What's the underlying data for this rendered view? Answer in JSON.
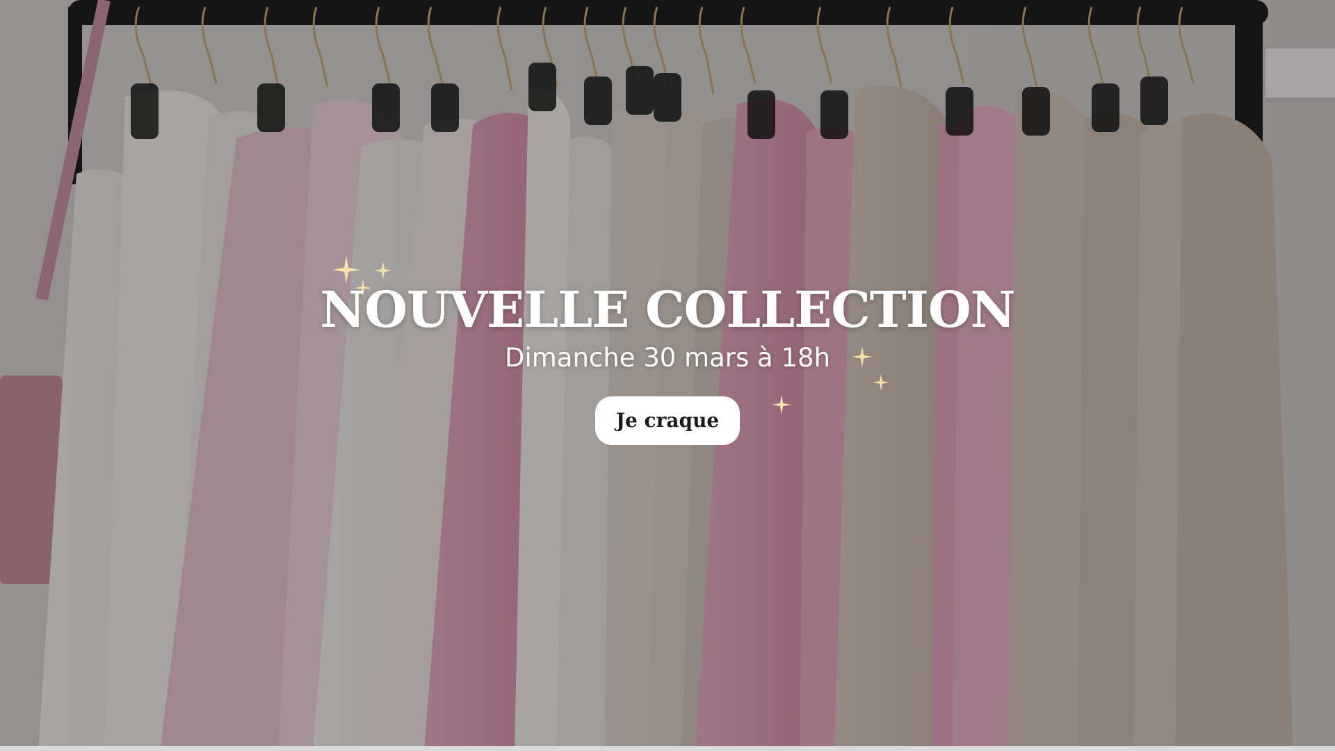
{
  "hero": {
    "title": "NOUVELLE COLLECTION",
    "subtitle": "Dimanche 30 mars à 18h",
    "cta_label": "Je craque",
    "image_alt": "clothing-rack-photo",
    "overlay_color": "#141414",
    "sparkle_color": "#f6e2a8"
  }
}
